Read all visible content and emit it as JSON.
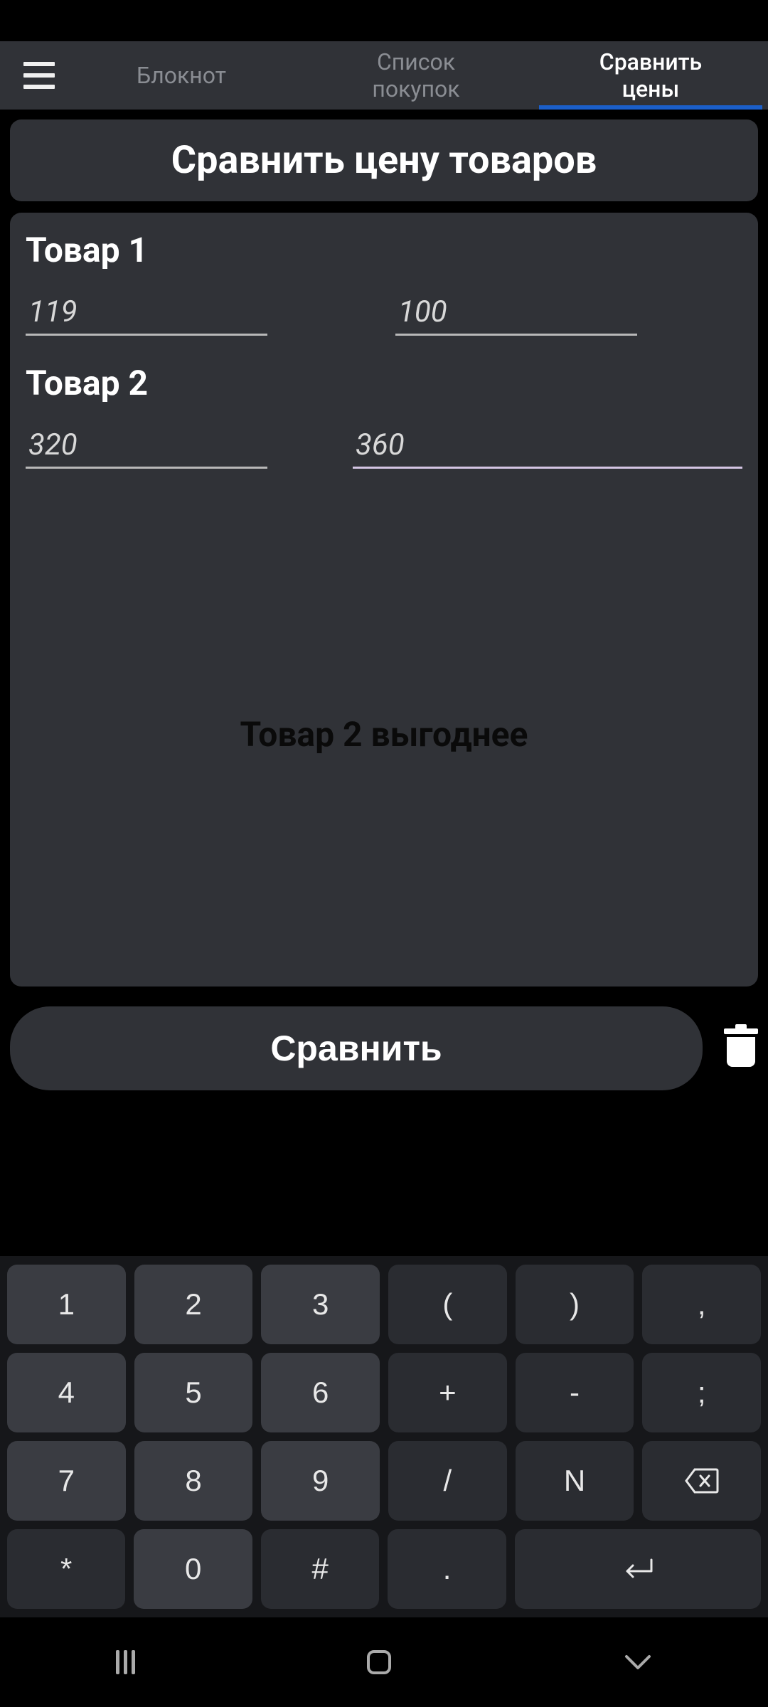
{
  "tabs": {
    "notepad": "Блокнот",
    "shopping": "Список\nпокупок",
    "compare": "Сравнить\nцены"
  },
  "active_tab": "compare",
  "title": "Сравнить цену товаров",
  "product1": {
    "label": "Товар 1",
    "value1": "119",
    "value2": "100"
  },
  "product2": {
    "label": "Товар 2",
    "value1": "320",
    "value2": "360"
  },
  "result": "Товар 2 выгоднее",
  "compare_button": "Сравнить",
  "keyboard": {
    "row1": [
      "1",
      "2",
      "3",
      "(",
      ")",
      ","
    ],
    "row2": [
      "4",
      "5",
      "6",
      "+",
      "-",
      ";"
    ],
    "row3": [
      "7",
      "8",
      "9",
      "/",
      "N"
    ],
    "row4": [
      "*",
      "0",
      "#",
      "."
    ]
  }
}
